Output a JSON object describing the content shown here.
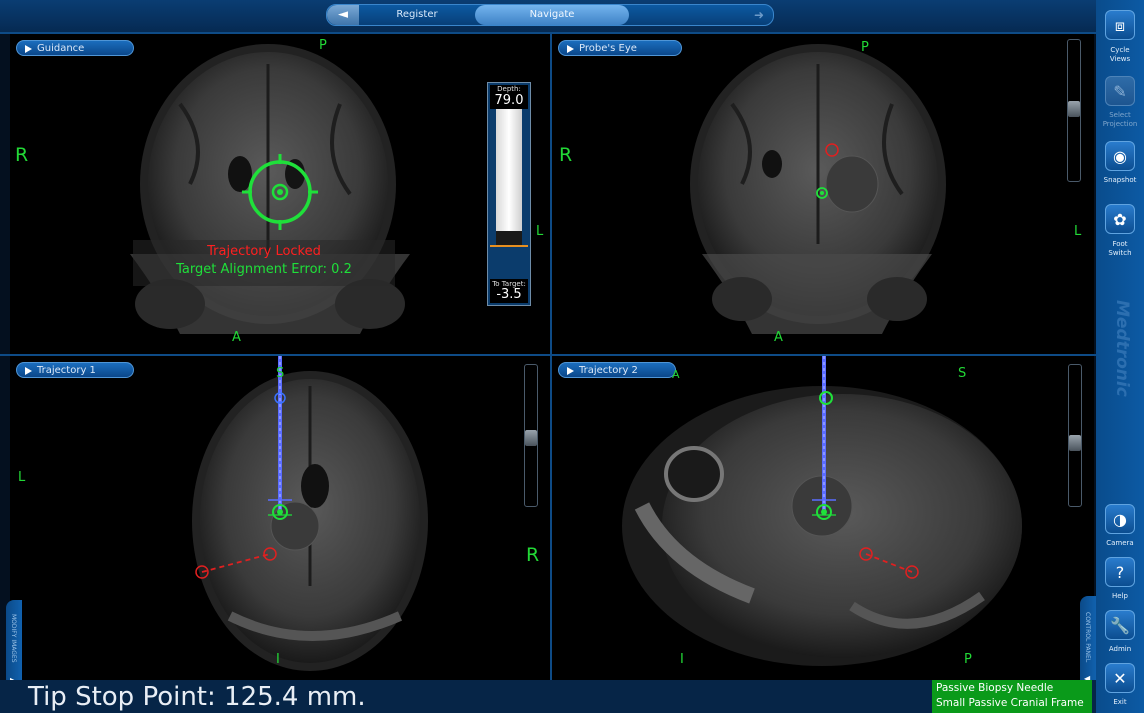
{
  "nav": {
    "back_icon": "arrow-left-icon",
    "forward_icon": "arrow-right-icon",
    "tabs": [
      {
        "label": "Register",
        "active": false
      },
      {
        "label": "Navigate",
        "active": true
      }
    ]
  },
  "viewports": {
    "guidance": {
      "label": "Guidance",
      "orient_top": "P",
      "orient_left": "R",
      "orient_right": "L",
      "orient_bottom": "A",
      "msg_locked": "Trajectory Locked",
      "msg_error": "Target Alignment Error: 0.2"
    },
    "probes_eye": {
      "label": "Probe's Eye",
      "orient_top": "P",
      "orient_left": "R",
      "orient_right": "L",
      "orient_bottom": "A"
    },
    "trajectory1": {
      "label": "Trajectory 1",
      "orient_top": "S",
      "orient_left": "L",
      "orient_right": "R",
      "orient_bottom": "I",
      "slider_level": 0.52
    },
    "trajectory2": {
      "label": "Trajectory 2",
      "orient_top_left": "A",
      "orient_top": "S",
      "orient_bottom_left": "I",
      "orient_bottom_right": "P",
      "slider_level": 0.56
    }
  },
  "probes_eye_slider_level": 0.49,
  "depth_gauge": {
    "depth_label": "Depth:",
    "depth_value": "79.0",
    "to_target_label": "To Target:",
    "to_target_value": "-3.5"
  },
  "sidebar": {
    "buttons": [
      {
        "name": "cycle-views",
        "label_line1": "Cycle",
        "label_line2": "Views",
        "icon": "cycle-views-icon",
        "enabled": true
      },
      {
        "name": "select-projection",
        "label_line1": "Select",
        "label_line2": "Projection",
        "icon": "pen-icon",
        "enabled": false
      },
      {
        "name": "snapshot",
        "label_line1": "Snapshot",
        "label_line2": "",
        "icon": "camera-icon",
        "enabled": true
      },
      {
        "name": "foot-switch",
        "label_line1": "Foot",
        "label_line2": "Switch",
        "icon": "foot-switch-icon",
        "enabled": true
      },
      {
        "name": "camera",
        "label_line1": "Camera",
        "label_line2": "",
        "icon": "tracking-camera-icon",
        "enabled": true
      },
      {
        "name": "help",
        "label_line1": "Help",
        "label_line2": "",
        "icon": "question-icon",
        "enabled": true
      },
      {
        "name": "admin",
        "label_line1": "Admin",
        "label_line2": "",
        "icon": "wrench-icon",
        "enabled": true
      },
      {
        "name": "exit",
        "label_line1": "Exit",
        "label_line2": "",
        "icon": "close-icon",
        "enabled": true
      }
    ],
    "brand": "Medtronic"
  },
  "side_tabs": {
    "left": "MODIFY IMAGES",
    "right": "CONTROL PANEL"
  },
  "status": {
    "tip_stop": "Tip Stop Point: 125.4 mm."
  },
  "tool": {
    "line1": "Passive Biopsy Needle",
    "line2": "Small Passive Cranial Frame"
  },
  "colors": {
    "orientation": "#22d836",
    "reticle": "#1fe03a",
    "trajectory": "#5b6cff",
    "marker_red": "#e02020",
    "msg_red": "#ff2020",
    "tool_bg": "#0a9a1a"
  }
}
